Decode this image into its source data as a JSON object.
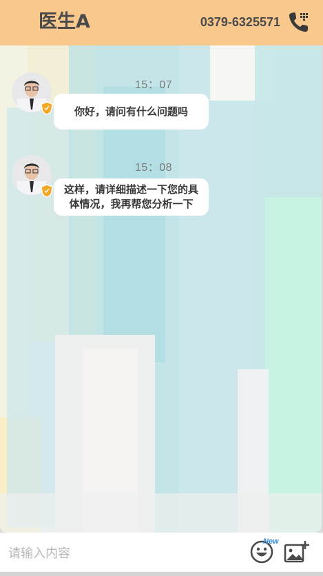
{
  "header": {
    "title": "医生A",
    "phone": "0379-6325571",
    "phone_icon": "phone-keypad-icon",
    "background_color": "#f9c88d"
  },
  "messages": [
    {
      "time": "15：07",
      "text": "你好，请问有什么问题吗",
      "sender_avatar": "doctor-avatar",
      "badge_icon": "shield-badge-icon"
    },
    {
      "time": "15：08",
      "text_lines": [
        "这样，请详细描述一下您的具",
        "体情况，我再帮您分析一下"
      ],
      "sender_avatar": "doctor-avatar",
      "badge_icon": "shield-badge-icon"
    }
  ],
  "input": {
    "placeholder": "请输入内容",
    "value": ""
  },
  "toolbar": {
    "emoji_icon": "emoji-icon",
    "new_label": "New",
    "image_icon": "add-image-icon"
  },
  "colors": {
    "badge": "#f5a623",
    "new_label": "#2f8ae0",
    "bubble": "#ffffff"
  }
}
